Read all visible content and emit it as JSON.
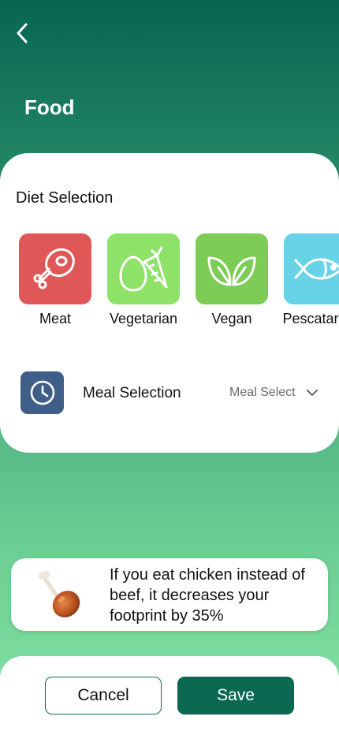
{
  "header": {
    "title": "Food"
  },
  "diet": {
    "title": "Diet Selection",
    "options": [
      {
        "label": "Meat",
        "icon": "meat-leg-icon",
        "color": "#e05757"
      },
      {
        "label": "Vegetarian",
        "icon": "egg-carrot-icon",
        "color": "#8ee267"
      },
      {
        "label": "Vegan",
        "icon": "leaves-icon",
        "color": "#7ccc55"
      },
      {
        "label": "Pescatarian",
        "icon": "fish-icon",
        "color": "#68d3e6"
      }
    ]
  },
  "meal": {
    "label": "Meal Selection",
    "select_value": "Meal Select",
    "icon": "clock-icon",
    "icon_color": "#3f5f88"
  },
  "tip": {
    "icon": "chicken-leg-icon",
    "text": "If you eat chicken instead of beef, it decreases your footprint by 35%"
  },
  "actions": {
    "cancel_label": "Cancel",
    "save_label": "Save"
  },
  "colors": {
    "primary": "#0b6851",
    "gradient_top": "#066650",
    "gradient_bottom": "#86e3a5"
  }
}
